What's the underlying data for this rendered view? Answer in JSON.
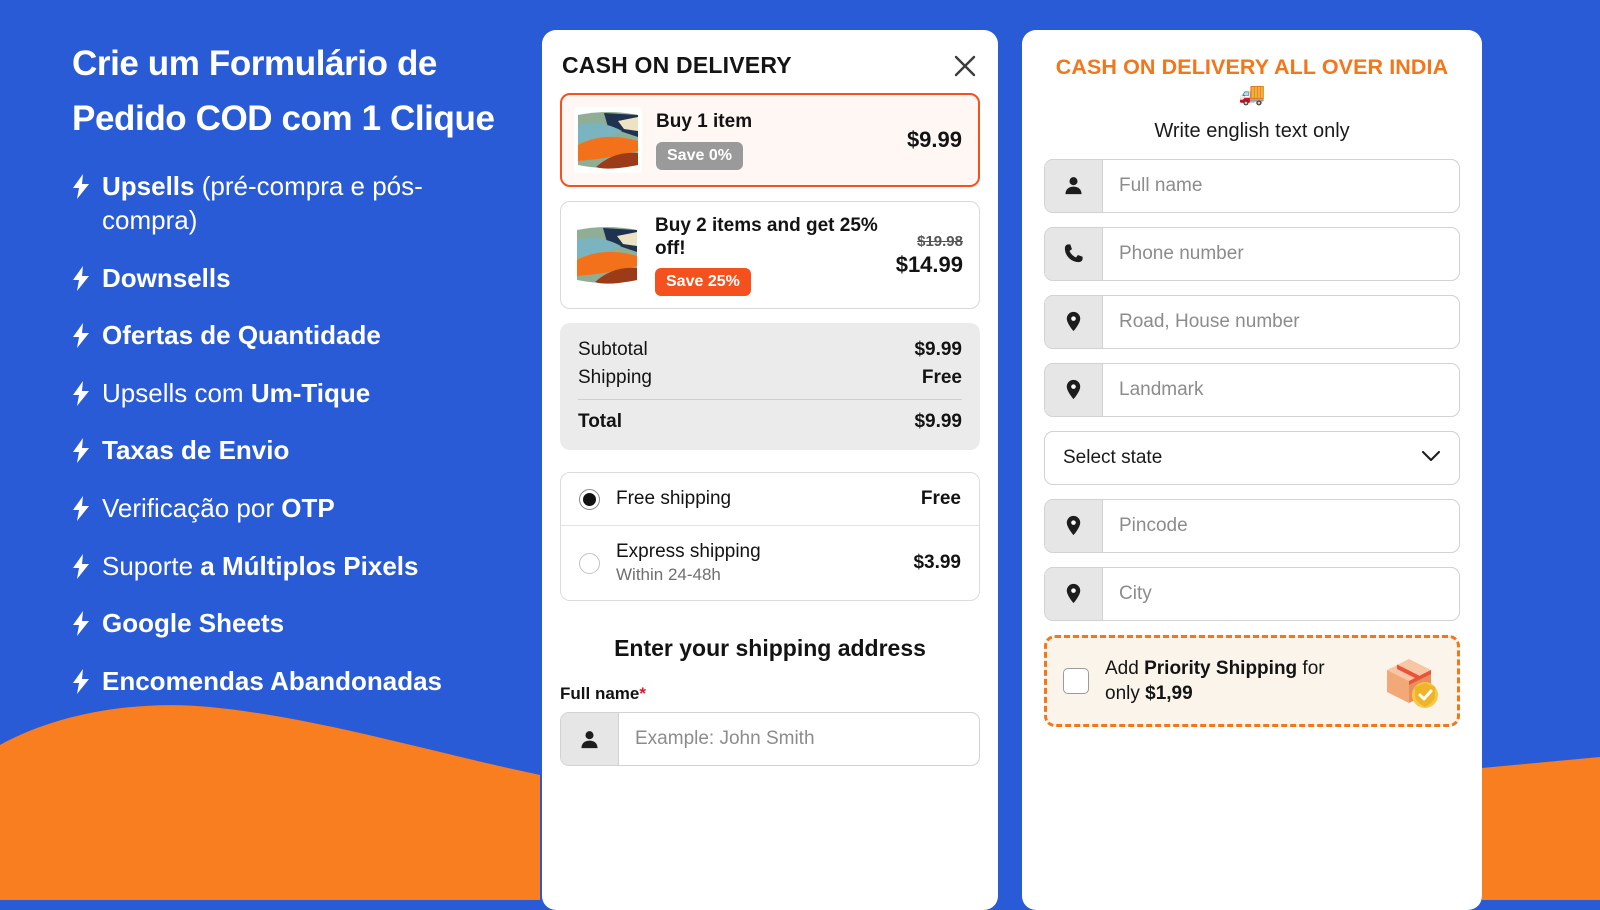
{
  "colors": {
    "blue": "#2A5BD7",
    "orange": "#F97E20",
    "accent_red": "#F4511E",
    "title_orange": "#F4761B"
  },
  "left_panel": {
    "title": "Crie um Formulário de Pedido COD com 1 Clique",
    "features": [
      {
        "icon": "bolt-icon",
        "bold": "Upsells",
        "rest": " (pré-compra e pós-compra)",
        "all_bold": false
      },
      {
        "icon": "bolt-icon",
        "bold": "Downsells",
        "rest": "",
        "all_bold": true
      },
      {
        "icon": "bolt-icon",
        "bold": "Ofertas de Quantidade",
        "rest": "",
        "all_bold": true
      },
      {
        "icon": "bolt-icon",
        "bold": "",
        "rest": "Upsells com ",
        "tail_bold": "Um-Tique",
        "all_bold": false
      },
      {
        "icon": "bolt-icon",
        "bold": "Taxas de Envio",
        "rest": "",
        "all_bold": true
      },
      {
        "icon": "bolt-icon",
        "bold": "",
        "rest": "Verificação por ",
        "tail_bold": "OTP",
        "all_bold": false
      },
      {
        "icon": "bolt-icon",
        "bold": "",
        "rest": "Suporte ",
        "tail_bold": "a Múltiplos Pixels",
        "all_bold": false
      },
      {
        "icon": "bolt-icon",
        "bold": "Google Sheets",
        "rest": "",
        "all_bold": true
      },
      {
        "icon": "bolt-icon",
        "bold": "Encomendas Abandonadas",
        "rest": "",
        "all_bold": true
      }
    ]
  },
  "middle_card": {
    "header": {
      "title": "CASH ON DELIVERY",
      "close_icon": "close-icon"
    },
    "offers": [
      {
        "title": "Buy 1 item",
        "badge": "Save 0%",
        "badge_style": "gray",
        "price": "$9.99",
        "price_old": "",
        "selected": true
      },
      {
        "title": "Buy 2 items and get 25% off!",
        "badge": "Save 25%",
        "badge_style": "red",
        "price": "$14.99",
        "price_old": "$19.98",
        "selected": false
      }
    ],
    "totals": [
      {
        "label": "Subtotal",
        "value": "$9.99"
      },
      {
        "label": "Shipping",
        "value": "Free"
      }
    ],
    "grand_total": {
      "label": "Total",
      "value": "$9.99"
    },
    "shipping_options": [
      {
        "name": "Free shipping",
        "sub": "",
        "price": "Free",
        "selected": true
      },
      {
        "name": "Express shipping",
        "sub": "Within 24-48h",
        "price": "$3.99",
        "selected": false
      }
    ],
    "address_heading": "Enter your shipping address",
    "full_name_label": "Full name",
    "required_mark": "*",
    "full_name_placeholder": "Example: John Smith",
    "full_name_icon": "person-icon"
  },
  "right_card": {
    "title": "CASH ON DELIVERY ALL OVER INDIA 🚚",
    "subtitle": "Write english text only",
    "fields": [
      {
        "placeholder": "Full name",
        "icon": "person-icon",
        "type": "input"
      },
      {
        "placeholder": "Phone number",
        "icon": "phone-icon",
        "type": "input"
      },
      {
        "placeholder": "Road, House number",
        "icon": "location-pin-icon",
        "type": "input"
      },
      {
        "placeholder": "Landmark",
        "icon": "location-pin-icon",
        "type": "input"
      },
      {
        "placeholder": "Select state",
        "icon": "chevron-down-icon",
        "type": "select"
      },
      {
        "placeholder": "Pincode",
        "icon": "location-pin-icon",
        "type": "input"
      },
      {
        "placeholder": "City",
        "icon": "location-pin-icon",
        "type": "input"
      }
    ],
    "priority": {
      "prefix": "Add ",
      "bold1": "Priority Shipping",
      "middle": " for only ",
      "bold2": "$1,99",
      "icon": "parcel-shield-icon"
    }
  }
}
